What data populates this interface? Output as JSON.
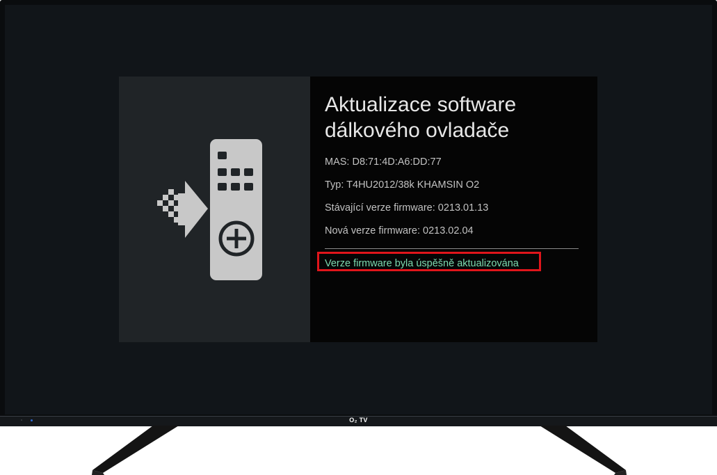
{
  "dialog": {
    "title_line1": "Aktualizace software",
    "title_line2": "dálkového ovladače",
    "mac": "MAS: D8:71:4D:A6:DD:77",
    "type": "Typ: T4HU2012/38k KHAMSIN O2",
    "current_fw": "Stávající verze firmware: 0213.01.13",
    "new_fw": "Nová verze firmware: 0213.02.04",
    "status": "Verze firmware byla úspěšně aktualizována",
    "icon": "remote-update-icon"
  },
  "tv": {
    "brand": "O₂ TV"
  },
  "colors": {
    "status_text": "#7ddab0",
    "highlight_border": "#e0151b",
    "dialog_bg": "#050505",
    "dialog_left_bg": "#202427"
  }
}
